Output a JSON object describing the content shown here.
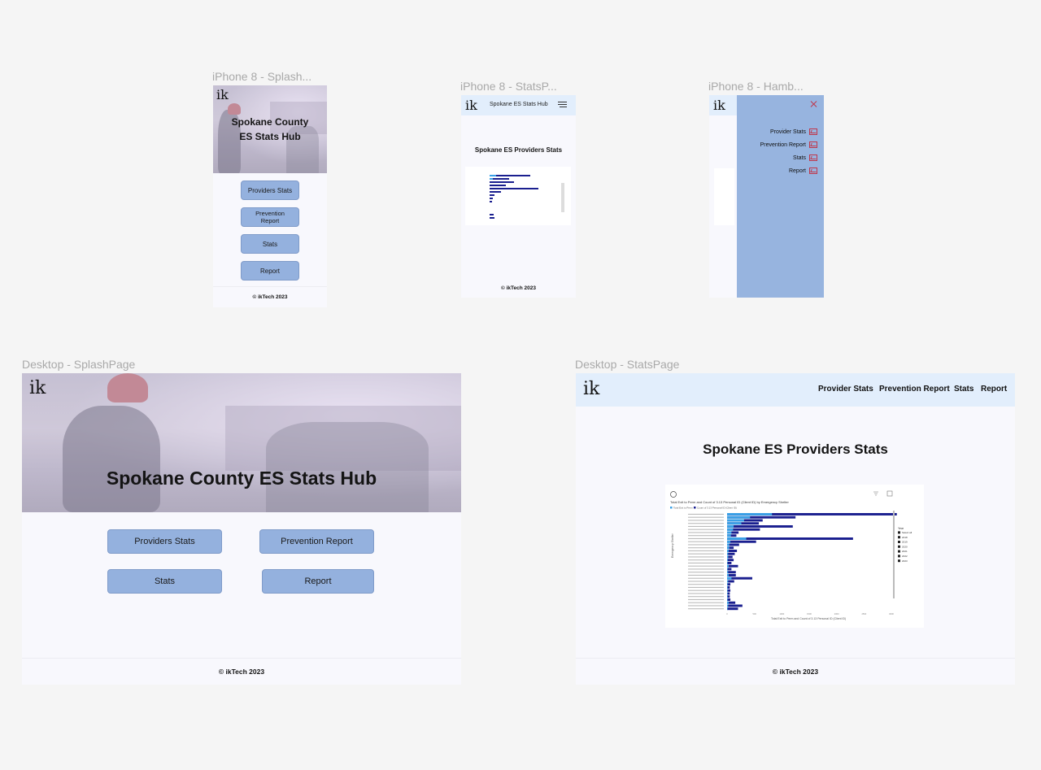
{
  "frames": {
    "iphone_splash": {
      "label": "iPhone 8 - Splash...",
      "logo": "ik",
      "title_line1": "Spokane County",
      "title_line2": "ES Stats Hub",
      "buttons": [
        "Providers Stats",
        "Prevention Report",
        "Stats",
        "Report"
      ],
      "footer": "© ikTech 2023"
    },
    "iphone_stats": {
      "label": "iPhone 8 - StatsP...",
      "logo": "ik",
      "header_title": "Spokane ES Stats Hub",
      "heading": "Spokane ES Providers Stats",
      "footer": "© ikTech 2023",
      "menu_icon": "hamburger-icon"
    },
    "iphone_hamburger": {
      "label": "iPhone 8 - Hamb...",
      "logo": "ik",
      "close_icon": "close-icon",
      "menu_items": [
        "Provider Stats",
        "Prevention Report",
        "Stats",
        "Report"
      ]
    },
    "desktop_splash": {
      "label": "Desktop - SplashPage",
      "logo": "ik",
      "title": "Spokane County ES Stats Hub",
      "buttons": [
        "Providers Stats",
        "Prevention Report",
        "Stats",
        "Report"
      ],
      "footer": "© ikTech 2023"
    },
    "desktop_stats": {
      "label": "Desktop - StatsPage",
      "logo": "ik",
      "nav": [
        "Provider Stats",
        "Prevention Report",
        "Stats",
        "Report"
      ],
      "heading": "Spokane ES Providers Stats",
      "footer": "© ikTech 2023"
    }
  },
  "colors": {
    "button": "#94b1de",
    "header_bg": "#e2eefc",
    "drawer_bg": "#97b4df",
    "bar_light": "#3aa0e6",
    "bar_dark": "#1a1f8f",
    "icon_red": "#c0364a"
  },
  "chart_data": {
    "type": "bar",
    "orientation": "horizontal",
    "title": "Total Exit to Perm and Count of 3.13 Personal ID (Client ID) by Emergency Shelter",
    "xlabel": "Total Exit to Perm and Count of 3.13 Personal ID (Client ID)",
    "ylabel": "Emergency Shelter",
    "xlim": [
      0,
      3000
    ],
    "x_ticks": [
      "0",
      "500",
      "1000",
      "1500",
      "2000",
      "2500",
      "3000"
    ],
    "legend_series": [
      "Total Exit to Perm",
      "Count of 3.13 Personal ID (Client ID)"
    ],
    "slicer_title": "Year",
    "slicer_items": [
      "Select all",
      "2018",
      "2019",
      "2020",
      "2021",
      "2022",
      "2023"
    ],
    "categories": [
      "c1",
      "c2",
      "c3",
      "c4",
      "c5",
      "c6",
      "c7",
      "c8",
      "c9",
      "c10",
      "c11",
      "c12",
      "c13",
      "c14",
      "c15",
      "c16",
      "c17",
      "c18",
      "c19",
      "c20",
      "c21",
      "c22",
      "c23",
      "c24",
      "c25",
      "c26",
      "c27",
      "c28",
      "c29",
      "c30",
      "c31",
      "c32"
    ],
    "series": [
      {
        "name": "Total Exit to Perm",
        "values": [
          820,
          420,
          310,
          260,
          120,
          110,
          80,
          70,
          350,
          60,
          40,
          40,
          30,
          20,
          20,
          15,
          10,
          30,
          10,
          20,
          30,
          80,
          20,
          10,
          10,
          10,
          10,
          10,
          10,
          30,
          20,
          10
        ]
      },
      {
        "name": "Count of 3.13 Personal ID (Client ID)",
        "values": [
          3100,
          1250,
          650,
          580,
          1200,
          600,
          210,
          170,
          2300,
          530,
          220,
          120,
          180,
          140,
          100,
          120,
          80,
          200,
          80,
          160,
          160,
          460,
          130,
          60,
          50,
          60,
          50,
          50,
          60,
          150,
          280,
          200
        ]
      }
    ]
  }
}
